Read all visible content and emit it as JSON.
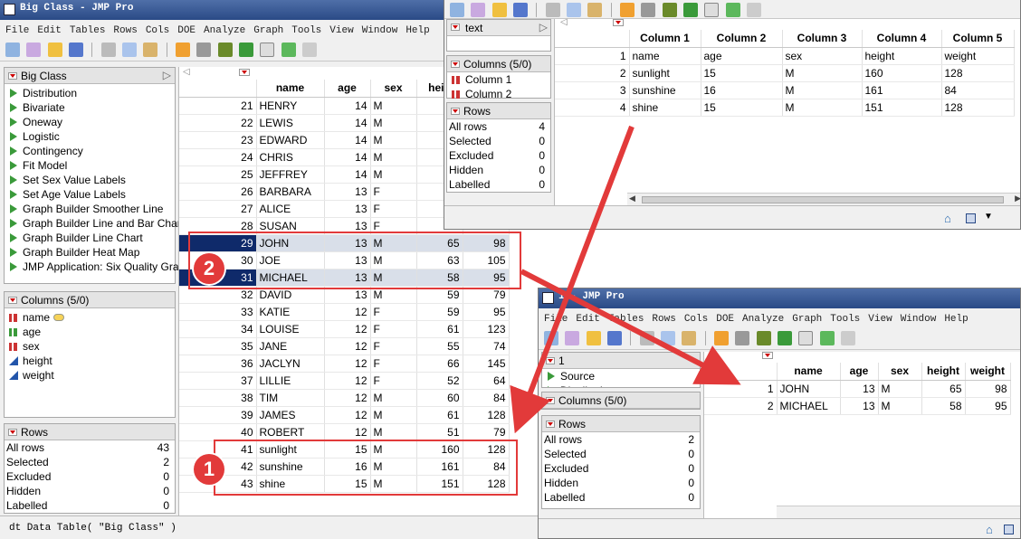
{
  "main": {
    "title": "Big Class - JMP Pro",
    "menu": [
      "File",
      "Edit",
      "Tables",
      "Rows",
      "Cols",
      "DOE",
      "Analyze",
      "Graph",
      "Tools",
      "View",
      "Window",
      "Help"
    ],
    "table_panel": {
      "name": "Big Class",
      "scripts": [
        "Distribution",
        "Bivariate",
        "Oneway",
        "Logistic",
        "Contingency",
        "Fit Model",
        "Set Sex Value Labels",
        "Set Age Value Labels",
        "Graph Builder Smoother Line",
        "Graph Builder Line and Bar Chart",
        "Graph Builder Line Chart",
        "Graph Builder Heat Map",
        "JMP Application: Six Quality Graphs"
      ]
    },
    "columns_panel": {
      "title": "Columns (5/0)",
      "columns": [
        "name",
        "age",
        "sex",
        "height",
        "weight"
      ]
    },
    "rows_panel": {
      "title": "Rows",
      "items": [
        {
          "label": "All rows",
          "value": "43"
        },
        {
          "label": "Selected",
          "value": "2"
        },
        {
          "label": "Excluded",
          "value": "0"
        },
        {
          "label": "Hidden",
          "value": "0"
        },
        {
          "label": "Labelled",
          "value": "0"
        }
      ]
    },
    "grid_headers": [
      "name",
      "age",
      "sex",
      "heig"
    ],
    "rows": [
      {
        "n": "21",
        "name": "HENRY",
        "age": "14",
        "sex": "M"
      },
      {
        "n": "22",
        "name": "LEWIS",
        "age": "14",
        "sex": "M"
      },
      {
        "n": "23",
        "name": "EDWARD",
        "age": "14",
        "sex": "M"
      },
      {
        "n": "24",
        "name": "CHRIS",
        "age": "14",
        "sex": "M"
      },
      {
        "n": "25",
        "name": "JEFFREY",
        "age": "14",
        "sex": "M"
      },
      {
        "n": "26",
        "name": "BARBARA",
        "age": "13",
        "sex": "F"
      },
      {
        "n": "27",
        "name": "ALICE",
        "age": "13",
        "sex": "F"
      },
      {
        "n": "28",
        "name": "SUSAN",
        "age": "13",
        "sex": "F"
      },
      {
        "n": "29",
        "name": "JOHN",
        "age": "13",
        "sex": "M",
        "height": "65",
        "weight": "98"
      },
      {
        "n": "30",
        "name": "JOE",
        "age": "13",
        "sex": "M",
        "height": "63",
        "weight": "105"
      },
      {
        "n": "31",
        "name": "MICHAEL",
        "age": "13",
        "sex": "M",
        "height": "58",
        "weight": "95"
      },
      {
        "n": "32",
        "name": "DAVID",
        "age": "13",
        "sex": "M",
        "height": "59",
        "weight": "79"
      },
      {
        "n": "33",
        "name": "KATIE",
        "age": "12",
        "sex": "F",
        "height": "59",
        "weight": "95"
      },
      {
        "n": "34",
        "name": "LOUISE",
        "age": "12",
        "sex": "F",
        "height": "61",
        "weight": "123"
      },
      {
        "n": "35",
        "name": "JANE",
        "age": "12",
        "sex": "F",
        "height": "55",
        "weight": "74"
      },
      {
        "n": "36",
        "name": "JACLYN",
        "age": "12",
        "sex": "F",
        "height": "66",
        "weight": "145"
      },
      {
        "n": "37",
        "name": "LILLIE",
        "age": "12",
        "sex": "F",
        "height": "52",
        "weight": "64"
      },
      {
        "n": "38",
        "name": "TIM",
        "age": "12",
        "sex": "M",
        "height": "60",
        "weight": "84"
      },
      {
        "n": "39",
        "name": "JAMES",
        "age": "12",
        "sex": "M",
        "height": "61",
        "weight": "128"
      },
      {
        "n": "40",
        "name": "ROBERT",
        "age": "12",
        "sex": "M",
        "height": "51",
        "weight": "79"
      },
      {
        "n": "41",
        "name": "sunlight",
        "age": "15",
        "sex": "M",
        "height": "160",
        "weight": "128"
      },
      {
        "n": "42",
        "name": "sunshine",
        "age": "16",
        "sex": "M",
        "height": "161",
        "weight": "84"
      },
      {
        "n": "43",
        "name": "shine",
        "age": "15",
        "sex": "M",
        "height": "151",
        "weight": "128"
      }
    ],
    "script_bar": "dt  Data Table( \"Big Class\" )"
  },
  "top_window": {
    "table_panel": {
      "name": "text"
    },
    "columns_panel": {
      "title": "Columns (5/0)",
      "columns": [
        "Column 1",
        "Column 2"
      ]
    },
    "rows_panel": {
      "title": "Rows",
      "items": [
        {
          "label": "All rows",
          "value": "4"
        },
        {
          "label": "Selected",
          "value": "0"
        },
        {
          "label": "Excluded",
          "value": "0"
        },
        {
          "label": "Hidden",
          "value": "0"
        },
        {
          "label": "Labelled",
          "value": "0"
        }
      ]
    },
    "grid_headers": [
      "Column 1",
      "Column 2",
      "Column 3",
      "Column 4",
      "Column 5"
    ],
    "rows": [
      {
        "n": "1",
        "c": [
          "name",
          "age",
          "sex",
          "height",
          "weight"
        ]
      },
      {
        "n": "2",
        "c": [
          "sunlight",
          "15",
          "M",
          "160",
          "128"
        ]
      },
      {
        "n": "3",
        "c": [
          "sunshine",
          "16",
          "M",
          "161",
          "84"
        ]
      },
      {
        "n": "4",
        "c": [
          "shine",
          "15",
          "M",
          "151",
          "128"
        ]
      }
    ]
  },
  "sub_window": {
    "title": "1 - JMP Pro",
    "menu": [
      "File",
      "Edit",
      "Tables",
      "Rows",
      "Cols",
      "DOE",
      "Analyze",
      "Graph",
      "Tools",
      "View",
      "Window",
      "Help"
    ],
    "table_panel": {
      "name": "1",
      "scripts": [
        "Source",
        "Distribution"
      ]
    },
    "columns_panel": {
      "title": "Columns (5/0)"
    },
    "rows_panel": {
      "title": "Rows",
      "items": [
        {
          "label": "All rows",
          "value": "2"
        },
        {
          "label": "Selected",
          "value": "0"
        },
        {
          "label": "Excluded",
          "value": "0"
        },
        {
          "label": "Hidden",
          "value": "0"
        },
        {
          "label": "Labelled",
          "value": "0"
        }
      ]
    },
    "grid_headers": [
      "name",
      "age",
      "sex",
      "height",
      "weight"
    ],
    "rows": [
      {
        "n": "1",
        "name": "JOHN",
        "age": "13",
        "sex": "M",
        "height": "65",
        "weight": "98"
      },
      {
        "n": "2",
        "name": "MICHAEL",
        "age": "13",
        "sex": "M",
        "height": "58",
        "weight": "95"
      }
    ]
  },
  "annotations": {
    "badge1": "1",
    "badge2": "2",
    "color": "#e23a3a"
  }
}
